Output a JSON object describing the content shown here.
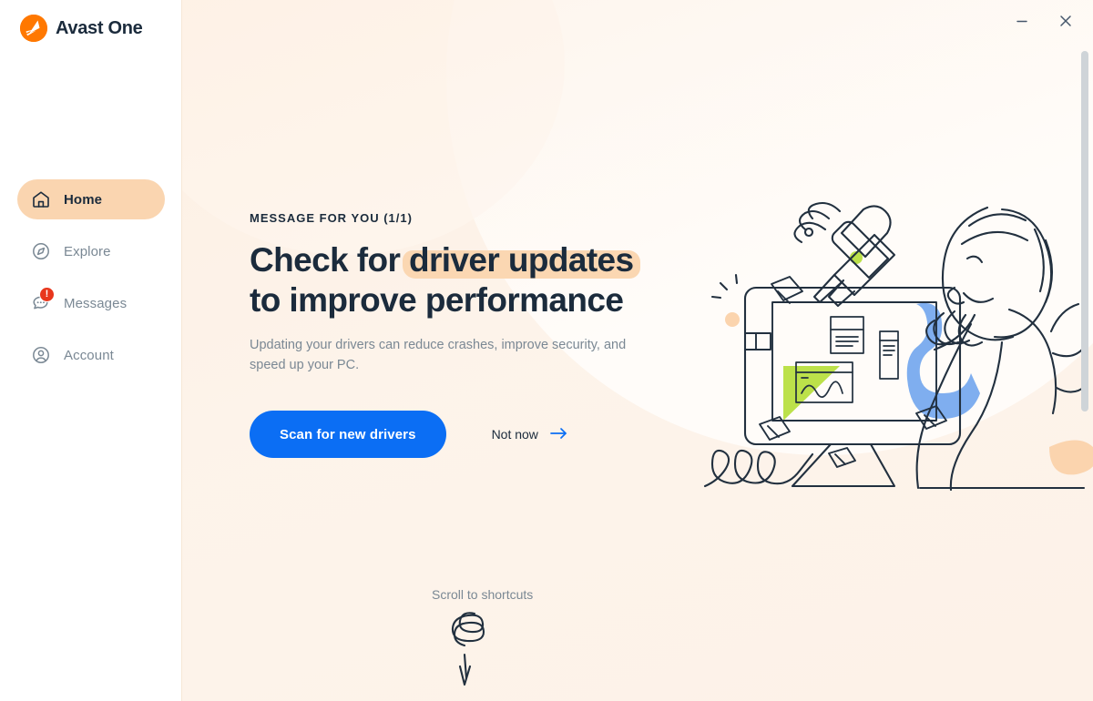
{
  "window": {
    "minimize_label": "–",
    "close_label": "✕"
  },
  "brand": {
    "name": "Avast One",
    "logo_icon": "avast-logo-icon"
  },
  "sidebar": {
    "items": [
      {
        "label": "Home",
        "icon": "home-icon",
        "active": true,
        "badge": ""
      },
      {
        "label": "Explore",
        "icon": "compass-icon",
        "active": false,
        "badge": ""
      },
      {
        "label": "Messages",
        "icon": "message-bubble-icon",
        "active": false,
        "badge": "!"
      },
      {
        "label": "Account",
        "icon": "account-circle-icon",
        "active": false,
        "badge": ""
      }
    ]
  },
  "message_card": {
    "eyebrow": "MESSAGE FOR YOU (1/1)",
    "headline_line1_pre": "Check for ",
    "headline_line1_highlight": "driver updates",
    "headline_line2": "to improve performance",
    "body": "Updating your drivers can reduce crashes, improve security, and speed up your PC.",
    "primary_button": "Scan for new drivers",
    "secondary_button": "Not now",
    "secondary_icon": "arrow-right-icon"
  },
  "scroll_hint": {
    "label": "Scroll to shortcuts",
    "icon": "curly-down-arrow-icon"
  },
  "illustration": {
    "name": "person-repairing-monitor-illustration"
  },
  "colors": {
    "brand_orange": "#FF7800",
    "accent_blue": "#0B6EF4",
    "active_pill_peach": "#FAD5B0",
    "highlight_peach": "#FBD7B2",
    "badge_red": "#E8361C",
    "text_dark": "#1B2B3C",
    "text_muted": "#7A8894",
    "illus_green": "#BCE14A",
    "illus_blue": "#7FAEEF",
    "illus_peach": "#FBD4AE",
    "page_bg": "#FDF2E8"
  }
}
